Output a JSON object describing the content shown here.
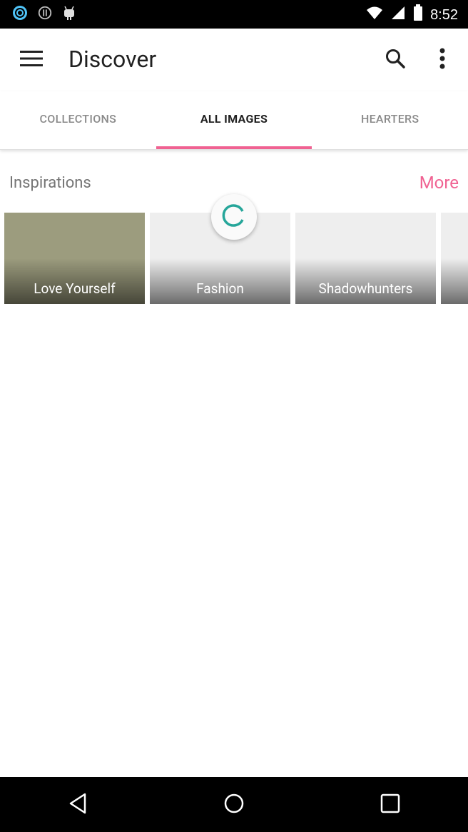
{
  "status_bar": {
    "time": "8:52",
    "left_icons": [
      "ring-notification-icon",
      "alert-circle-icon",
      "android-icon"
    ],
    "right_icons": [
      "wifi-icon",
      "signal-icon",
      "battery-icon"
    ]
  },
  "app_bar": {
    "title": "Discover",
    "menu_icon": "hamburger-menu-icon",
    "search_icon": "search-icon",
    "overflow_icon": "more-vertical-icon"
  },
  "tabs": [
    {
      "label": "COLLECTIONS",
      "active": false
    },
    {
      "label": "ALL IMAGES",
      "active": true
    },
    {
      "label": "HEARTERS",
      "active": false
    }
  ],
  "section": {
    "title": "Inspirations",
    "more_label": "More"
  },
  "tiles": [
    {
      "label": "Love Yourself"
    },
    {
      "label": "Fashion"
    },
    {
      "label": "Shadowhunters"
    },
    {
      "label": ""
    }
  ],
  "colors": {
    "accent": "#f06292",
    "spinner": "#26a69a",
    "tile_olive": "#9c9c7e"
  },
  "nav_bar": {
    "icons": [
      "back-icon",
      "home-icon",
      "recents-icon"
    ]
  }
}
